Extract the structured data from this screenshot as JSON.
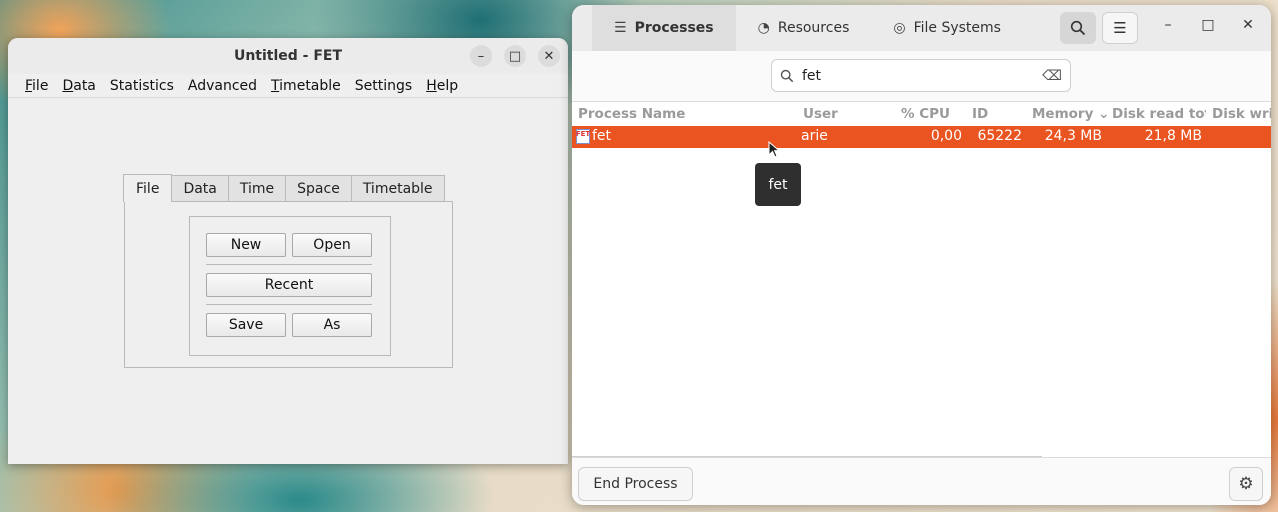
{
  "fet": {
    "title": "Untitled - FET",
    "window_controls": {
      "minimize": "–",
      "maximize": "□",
      "close": "✕"
    },
    "menu": [
      {
        "pre": "",
        "ul": "F",
        "post": "ile"
      },
      {
        "pre": "",
        "ul": "D",
        "post": "ata"
      },
      {
        "pre": "Statistics",
        "ul": "",
        "post": ""
      },
      {
        "pre": "Advanced",
        "ul": "",
        "post": ""
      },
      {
        "pre": "",
        "ul": "T",
        "post": "imetable"
      },
      {
        "pre": "Settings",
        "ul": "",
        "post": ""
      },
      {
        "pre": "",
        "ul": "H",
        "post": "elp"
      }
    ],
    "tabs": [
      "File",
      "Data",
      "Time",
      "Space",
      "Timetable"
    ],
    "active_tab": "File",
    "buttons": {
      "new": "New",
      "open": "Open",
      "recent": "Recent",
      "save": "Save",
      "as": "As"
    }
  },
  "monitor": {
    "tabs": [
      {
        "label": "Processes",
        "icon": "list-icon",
        "active": true
      },
      {
        "label": "Resources",
        "icon": "gauge-icon",
        "active": false
      },
      {
        "label": "File Systems",
        "icon": "disk-icon",
        "active": false
      }
    ],
    "search_value": "fet",
    "columns": [
      "Process Name",
      "User",
      "% CPU",
      "ID",
      "Memory",
      "Disk read tota",
      "Disk writ"
    ],
    "rows": [
      {
        "name": "fet",
        "user": "arie",
        "cpu": "0,00",
        "id": "65222",
        "memory": "24,3 MB",
        "disk_read": "21,8 MB",
        "disk_write": ""
      }
    ],
    "tooltip": "fet",
    "end_process_label": "End Process",
    "accent_color": "#e95420"
  }
}
